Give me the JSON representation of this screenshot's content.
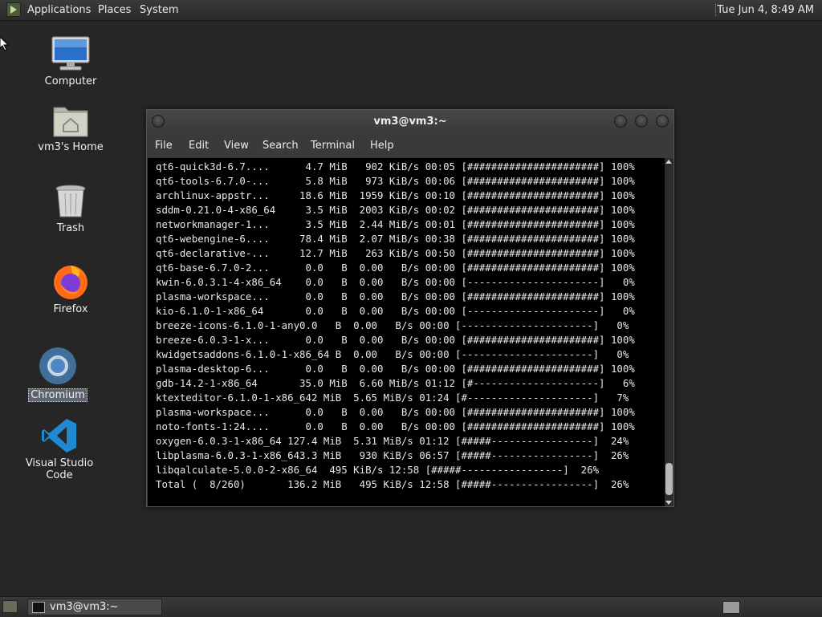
{
  "top_panel": {
    "menus": [
      "Applications",
      "Places",
      "System"
    ],
    "clock": "Tue Jun  4,  8:49 AM"
  },
  "desktop_icons": [
    {
      "label": "Computer",
      "icon": "computer-icon"
    },
    {
      "label": "vm3's Home",
      "icon": "home-folder-icon"
    },
    {
      "label": "Trash",
      "icon": "trash-icon"
    },
    {
      "label": "Firefox",
      "icon": "firefox-icon"
    },
    {
      "label": "Chromium",
      "icon": "chromium-icon",
      "selected": true
    },
    {
      "label": "Visual Studio Code",
      "icon": "vscode-icon"
    }
  ],
  "terminal": {
    "title": "vm3@vm3:~",
    "menu": [
      "File",
      "Edit",
      "View",
      "Search",
      "Terminal",
      "Help"
    ],
    "lines": [
      "qt6-quick3d-6.7....      4.7 MiB   902 KiB/s 00:05 [######################] 100%",
      "qt6-tools-6.7.0-...      5.8 MiB   973 KiB/s 00:06 [######################] 100%",
      "archlinux-appstr...     18.6 MiB  1959 KiB/s 00:10 [######################] 100%",
      "sddm-0.21.0-4-x86_64     3.5 MiB  2003 KiB/s 00:02 [######################] 100%",
      "networkmanager-1...      3.5 MiB  2.44 MiB/s 00:01 [######################] 100%",
      "qt6-webengine-6....     78.4 MiB  2.07 MiB/s 00:38 [######################] 100%",
      "qt6-declarative-...     12.7 MiB   263 KiB/s 00:50 [######################] 100%",
      "qt6-base-6.7.0-2...      0.0   B  0.00   B/s 00:00 [######################] 100%",
      "kwin-6.0.3.1-4-x86_64    0.0   B  0.00   B/s 00:00 [----------------------]   0%",
      "plasma-workspace...      0.0   B  0.00   B/s 00:00 [######################] 100%",
      "kio-6.1.0-1-x86_64       0.0   B  0.00   B/s 00:00 [----------------------]   0%",
      "breeze-icons-6.1.0-1-any0.0   B  0.00   B/s 00:00 [----------------------]   0%",
      "breeze-6.0.3-1-x...      0.0   B  0.00   B/s 00:00 [######################] 100%",
      "kwidgetsaddons-6.1.0-1-x86_64 B  0.00   B/s 00:00 [----------------------]   0%",
      "plasma-desktop-6...      0.0   B  0.00   B/s 00:00 [######################] 100%",
      "gdb-14.2-1-x86_64       35.0 MiB  6.60 MiB/s 01:12 [#---------------------]   6%",
      "ktexteditor-6.1.0-1-x86_642 MiB  5.65 MiB/s 01:24 [#---------------------]   7%",
      "plasma-workspace...      0.0   B  0.00   B/s 00:00 [######################] 100%",
      "noto-fonts-1:24....      0.0   B  0.00   B/s 00:00 [######################] 100%",
      "oxygen-6.0.3-1-x86_64 127.4 MiB  5.31 MiB/s 01:12 [#####-----------------]  24%",
      "libplasma-6.0.3-1-x86_643.3 MiB   930 KiB/s 06:57 [#####-----------------]  26%",
      "libqalculate-5.0.0-2-x86_64  495 KiB/s 12:58 [#####-----------------]  26%",
      "Total (  8/260)       136.2 MiB   495 KiB/s 12:58 [#####-----------------]  26%"
    ]
  },
  "taskbar": {
    "task_label": "vm3@vm3:~"
  }
}
